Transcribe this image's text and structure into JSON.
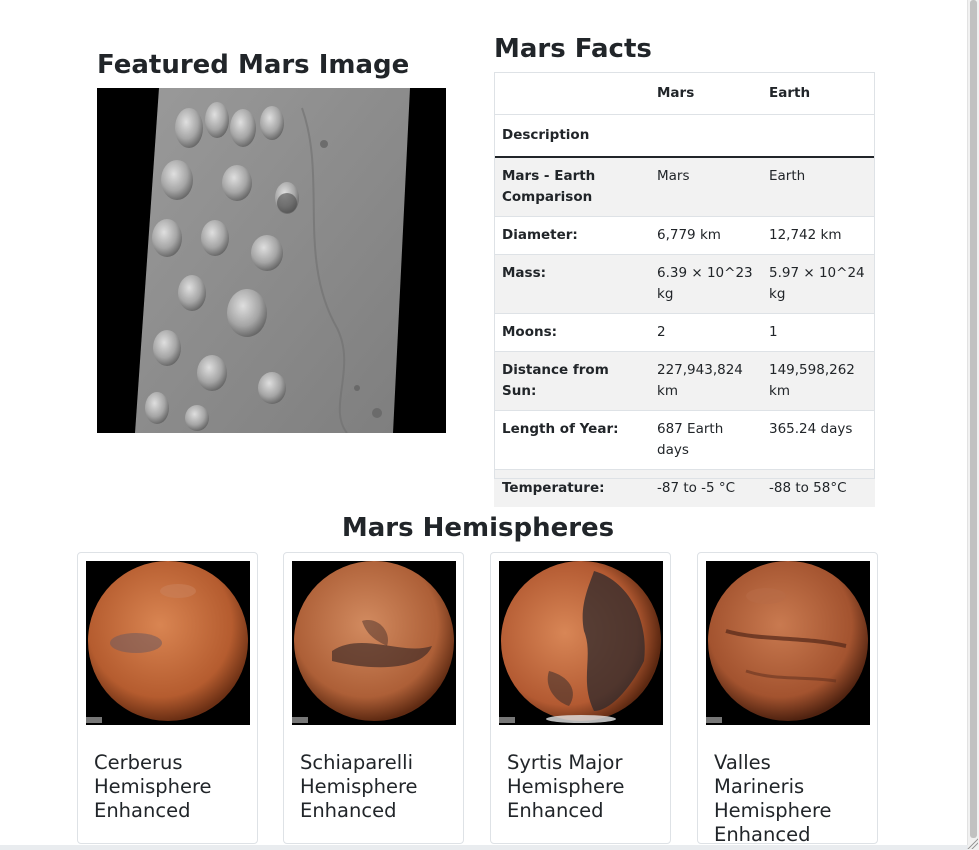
{
  "featured": {
    "title": "Featured Mars Image",
    "image_icon": "mars-surface-photo"
  },
  "facts": {
    "title": "Mars Facts",
    "columns": [
      "",
      "Mars",
      "Earth"
    ],
    "header_row_label": "Description",
    "rows": [
      {
        "label": "Mars - Earth Comparison",
        "mars": "Mars",
        "earth": "Earth"
      },
      {
        "label": "Diameter:",
        "mars": "6,779 km",
        "earth": "12,742 km"
      },
      {
        "label": "Mass:",
        "mars": "6.39 × 10^23 kg",
        "earth": "5.97 × 10^24 kg"
      },
      {
        "label": "Moons:",
        "mars": "2",
        "earth": "1"
      },
      {
        "label": "Distance from Sun:",
        "mars": "227,943,824 km",
        "earth": "149,598,262 km"
      },
      {
        "label": "Length of Year:",
        "mars": "687 Earth days",
        "earth": "365.24 days"
      },
      {
        "label": "Temperature:",
        "mars": "-87 to -5 °C",
        "earth": "-88 to 58°C"
      }
    ]
  },
  "hemispheres": {
    "title": "Mars Hemispheres",
    "items": [
      {
        "title": "Cerberus Hemisphere Enhanced",
        "color": "#c26a3b"
      },
      {
        "title": "Schiaparelli Hemisphere Enhanced",
        "color": "#b8683f"
      },
      {
        "title": "Syrtis Major Hemisphere Enhanced",
        "color": "#b9603a"
      },
      {
        "title": "Valles Marineris Hemisphere Enhanced",
        "color": "#a45233"
      }
    ]
  }
}
